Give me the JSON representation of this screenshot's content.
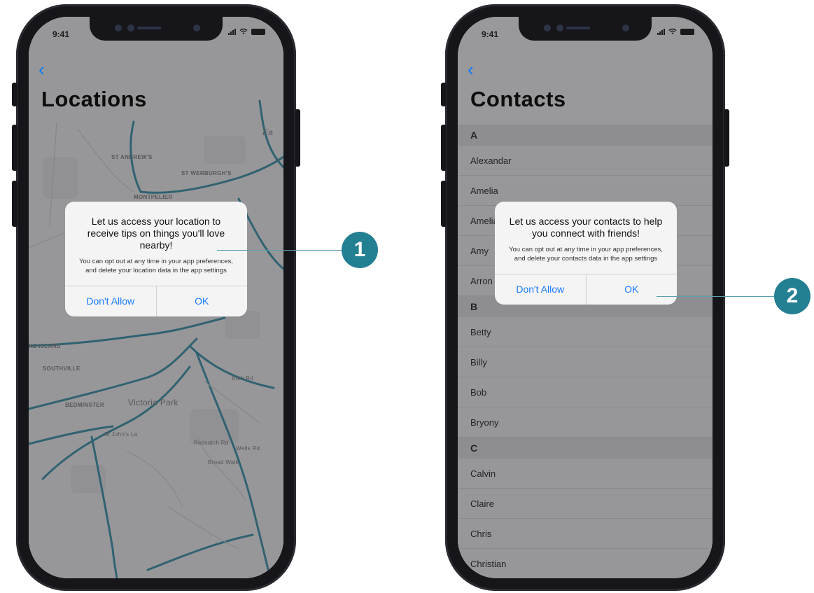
{
  "status_bar": {
    "time": "9:41"
  },
  "locations_screen": {
    "title": "Locations",
    "map_labels": [
      "ST ANDREW'S",
      "ST WERBURGH'S",
      "MONTPELIER",
      "KE ISLAND",
      "SOUTHVILLE",
      "BEDMINSTER",
      "Victoria Park",
      "St John's La",
      "Redcatch Rd",
      "Broad Walk",
      "Wells Rd",
      "Bath Rd",
      "Ea"
    ],
    "alert": {
      "title": "Let us access your location to receive tips on things you'll love nearby!",
      "body": "You can opt out at any time in your app preferences, and delete your location data in the app settings",
      "deny_label": "Don't Allow",
      "ok_label": "OK"
    },
    "callout": "1"
  },
  "contacts_screen": {
    "title": "Contacts",
    "sections": [
      {
        "letter": "A",
        "contacts": [
          "Alexandar",
          "Amelia",
          "Amelia",
          "Amy",
          "Arron"
        ]
      },
      {
        "letter": "B",
        "contacts": [
          "Betty",
          "Billy",
          "Bob",
          "Bryony"
        ]
      },
      {
        "letter": "C",
        "contacts": [
          "Calvin",
          "Claire",
          "Chris",
          "Christian"
        ]
      }
    ],
    "alert": {
      "title": "Let us access your contacts to help you connect with friends!",
      "body": "You can opt out at any time in your app preferences, and delete your contacts data in the app settings",
      "deny_label": "Don't Allow",
      "ok_label": "OK"
    },
    "callout": "2"
  },
  "colors": {
    "accent": "#237f92",
    "road": "#2a7e94",
    "ios_blue": "#1a7bff"
  }
}
